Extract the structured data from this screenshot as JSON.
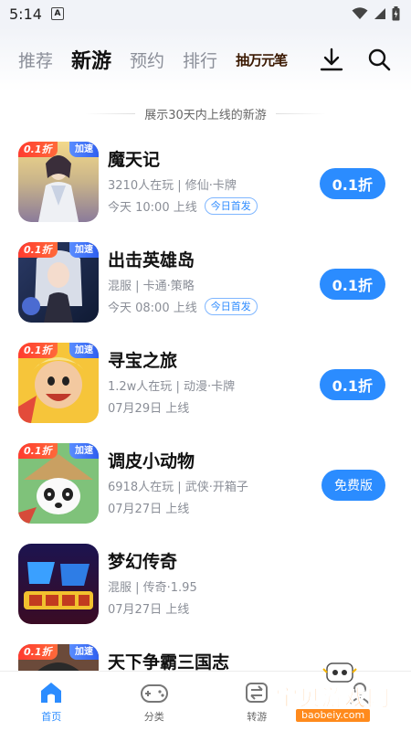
{
  "status_bar": {
    "time": "5:14",
    "notif_letter": "A"
  },
  "nav": {
    "tabs": [
      "推荐",
      "新游",
      "预约",
      "排行"
    ],
    "active_index": 1,
    "promo": "抽万元笔"
  },
  "notice": "展示30天内上线的新游",
  "games": [
    {
      "name": "魔天记",
      "meta": "3210人在玩 | 修仙·卡牌",
      "date": "今天 10:00 上线",
      "badge": "今日首发",
      "button": "0.1折",
      "discount_tag": "0.1折",
      "speed_tag": "加速"
    },
    {
      "name": "出击英雄岛",
      "meta": "混服 | 卡通·策略",
      "date": "今天 08:00 上线",
      "badge": "今日首发",
      "button": "0.1折",
      "discount_tag": "0.1折",
      "speed_tag": "加速"
    },
    {
      "name": "寻宝之旅",
      "meta": "1.2w人在玩 | 动漫·卡牌",
      "date": "07月29日 上线",
      "badge": "",
      "button": "0.1折",
      "discount_tag": "0.1折",
      "speed_tag": "加速"
    },
    {
      "name": "调皮小动物",
      "meta": "6918人在玩 | 武侠·开箱子",
      "date": "07月27日 上线",
      "badge": "",
      "button": "免费版",
      "discount_tag": "0.1折",
      "speed_tag": "加速"
    },
    {
      "name": "梦幻传奇",
      "meta": "混服 | 传奇·1.95",
      "date": "07月27日 上线",
      "badge": "",
      "button": "",
      "discount_tag": "",
      "speed_tag": ""
    },
    {
      "name": "天下争霸三国志",
      "meta": "",
      "date": "",
      "badge": "",
      "button": "",
      "discount_tag": "0.1折",
      "speed_tag": "加速"
    }
  ],
  "bottom_nav": [
    {
      "label": "首页",
      "icon": "home-icon",
      "active": true
    },
    {
      "label": "分类",
      "icon": "gamepad-icon",
      "active": false
    },
    {
      "label": "转游",
      "icon": "transfer-icon",
      "active": false
    },
    {
      "label": "我的",
      "icon": "user-icon",
      "active": false
    }
  ],
  "watermark": {
    "title": "宝贝游戏网",
    "url": "baobeiy.com"
  },
  "colors": {
    "accent": "#2b8cff",
    "discount": "#ff3b2f",
    "speed": "#2f5ff0",
    "text_muted": "#8a8e97"
  }
}
